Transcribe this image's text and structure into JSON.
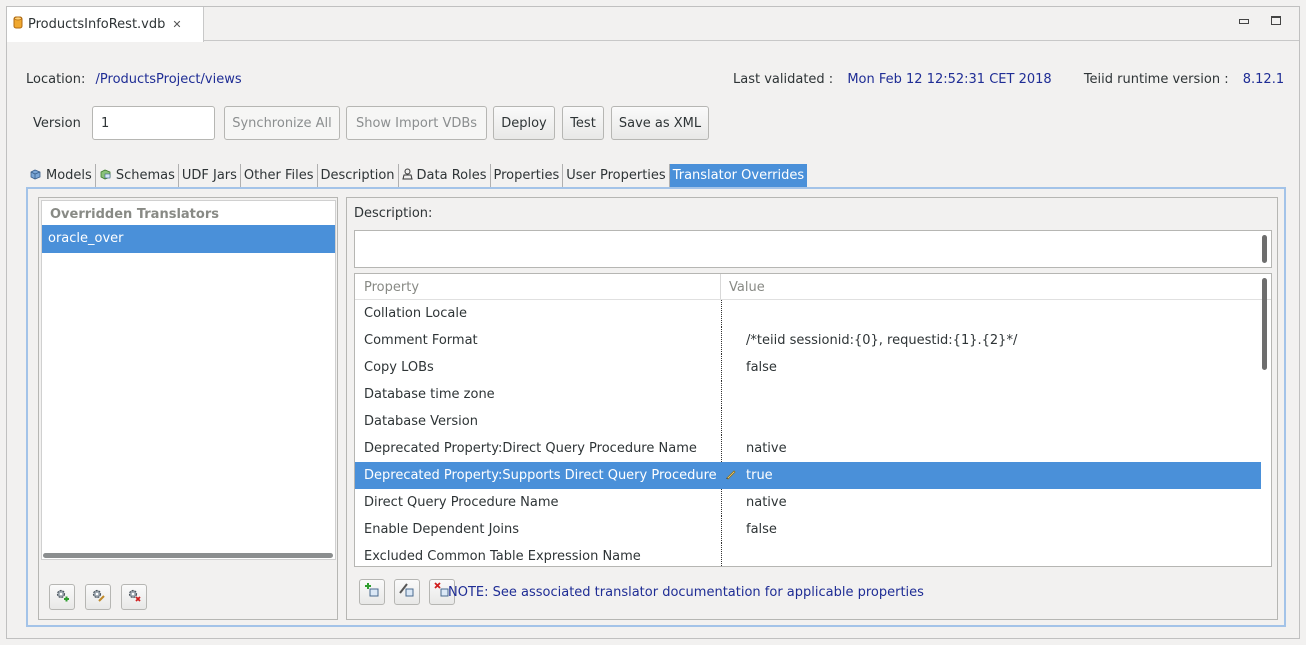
{
  "editor": {
    "tab_title": "ProductsInfoRest.vdb",
    "tab_close": "✕"
  },
  "info": {
    "location_label": "Location:",
    "location_value": "/ProductsProject/views",
    "last_validated_label": "Last validated :",
    "last_validated_value": "Mon Feb 12 12:52:31 CET 2018",
    "runtime_label": "Teiid runtime version :",
    "runtime_value": "8.12.1"
  },
  "toolbar": {
    "version_label": "Version",
    "version_value": "1",
    "synchronize_all": "Synchronize All",
    "show_import_vdbs": "Show Import VDBs",
    "deploy": "Deploy",
    "test": "Test",
    "save_as_xml": "Save as XML"
  },
  "tabs": [
    {
      "label": "Models",
      "icon": "models-icon"
    },
    {
      "label": "Schemas",
      "icon": "schemas-icon"
    },
    {
      "label": "UDF Jars"
    },
    {
      "label": "Other Files"
    },
    {
      "label": "Description"
    },
    {
      "label": "Data Roles",
      "icon": "data-roles-icon"
    },
    {
      "label": "Properties"
    },
    {
      "label": "User Properties"
    },
    {
      "label": "Translator Overrides",
      "active": true
    }
  ],
  "overridden": {
    "header": "Overridden Translators",
    "items": [
      "oracle_over"
    ]
  },
  "details": {
    "description_label": "Description:",
    "description_value": "",
    "columns": [
      "Property",
      "Value"
    ],
    "rows": [
      {
        "property": "Collation Locale",
        "value": ""
      },
      {
        "property": "Comment Format",
        "value": "/*teiid sessionid:{0}, requestid:{1}.{2}*/"
      },
      {
        "property": "Copy LOBs",
        "value": "false"
      },
      {
        "property": "Database time zone",
        "value": ""
      },
      {
        "property": "Database Version",
        "value": ""
      },
      {
        "property": "Deprecated Property:Direct Query Procedure Name",
        "value": "native"
      },
      {
        "property": "Deprecated Property:Supports Direct Query Procedure",
        "value": "true",
        "selected": true
      },
      {
        "property": "Direct Query Procedure Name",
        "value": "native"
      },
      {
        "property": "Enable Dependent Joins",
        "value": "false"
      },
      {
        "property": "Excluded Common Table Expression Name",
        "value": ""
      }
    ],
    "note": "NOTE:  See associated translator documentation for applicable properties"
  },
  "colors": {
    "selection": "#4a90d9",
    "link": "#1f2d95",
    "focus_border": "#a3c3e8"
  }
}
